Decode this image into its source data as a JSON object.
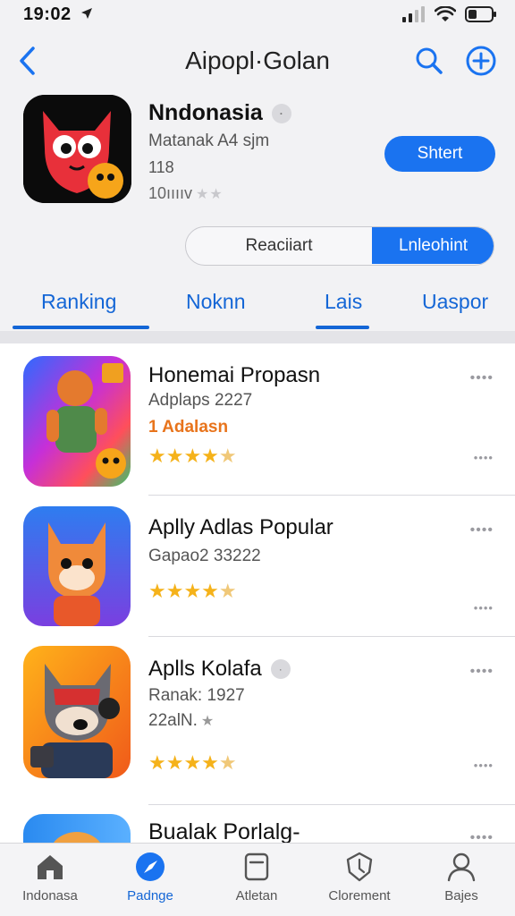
{
  "status_bar": {
    "time": "19:02",
    "location_icon": "location-arrow-icon",
    "signal_icon": "cellular-signal-icon",
    "wifi_icon": "wifi-icon",
    "battery_icon": "battery-icon"
  },
  "nav": {
    "title": "Aipopl·Golan",
    "back_icon": "chevron-left-icon",
    "search_icon": "search-icon",
    "add_icon": "plus-circle-icon"
  },
  "hero": {
    "name": "Nndonasia",
    "badge": "·",
    "subtitle": "Matanak A4 sjm",
    "count": "118",
    "rating_text": "10ııııv",
    "rating_stars": "★★",
    "get_label": "Shtert"
  },
  "segmented": {
    "left_label": "Reaciiart",
    "right_label": "Lnleohint"
  },
  "tabs": [
    {
      "label": "Ranking"
    },
    {
      "label": "Noknn"
    },
    {
      "label": "Lais"
    },
    {
      "label": "Uaspor"
    }
  ],
  "list": [
    {
      "title": "Honemai Propasn",
      "subtitle": "Adplaps 2227",
      "highlight": "1 Adalasn",
      "stars": 4.5,
      "more": "••••"
    },
    {
      "title": "Aplly Adlas Popular",
      "subtitle": "Gapao2 33222",
      "stars": 4.5,
      "more": "••••"
    },
    {
      "title": "Aplls Kolafa",
      "title_badge": "·",
      "subtitle": "Ranak: 1927",
      "subtitle2": "22alN.",
      "subtitle2_star": "★",
      "stars": 4.5,
      "more": "••••"
    },
    {
      "title": "Bualak Porlalg-",
      "more": "••••"
    }
  ],
  "tab_bar": [
    {
      "label": "Indonasa",
      "icon": "home-icon",
      "active": false
    },
    {
      "label": "Padnge",
      "icon": "compass-icon",
      "active": true
    },
    {
      "label": "Atletan",
      "icon": "card-icon",
      "active": false
    },
    {
      "label": "Clorement",
      "icon": "shield-icon",
      "active": false
    },
    {
      "label": "Bajes",
      "icon": "person-icon",
      "active": false
    }
  ],
  "colors": {
    "accent": "#1a73f0",
    "tab_text": "#1466d6",
    "star": "#f5b21a",
    "highlight": "#e8741c"
  }
}
